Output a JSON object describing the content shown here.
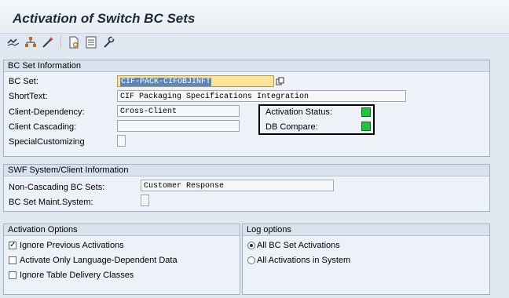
{
  "window": {
    "title": "Activation of Switch BC Sets"
  },
  "toolbar": {
    "icons": [
      "execute-icon",
      "hierarchy-icon",
      "magic-wand-icon",
      "document-icon",
      "details-icon",
      "wrench-icon"
    ]
  },
  "bc_set_info": {
    "header": "BC Set Information",
    "bc_set_label": "BC Set:",
    "bc_set_value": "CIF-PACK-CIFOBJINFT",
    "shorttext_label": "ShortText:",
    "shorttext_value": "CIF Packaging Specifications Integration",
    "client_dependency_label": "Client-Dependency:",
    "client_dependency_value": "Cross-Client",
    "client_cascading_label": "Client Cascading:",
    "client_cascading_value": "",
    "special_customizing_label": "SpecialCustomizing",
    "activation_status_label": "Activation Status:",
    "db_compare_label": "DB Compare:",
    "status_color": "#22c33a"
  },
  "swf_info": {
    "header": "SWF System/Client Information",
    "noncascading_label": "Non-Cascading BC Sets:",
    "noncascading_value": "Customer Response",
    "maint_system_label": "BC Set Maint.System:"
  },
  "activation_options": {
    "header": "Activation Options",
    "options": [
      {
        "label": "Ignore Previous Activations",
        "checked": true
      },
      {
        "label": "Activate Only Language-Dependent Data",
        "checked": false
      },
      {
        "label": "Ignore Table Delivery Classes",
        "checked": false
      }
    ]
  },
  "log_options": {
    "header": "Log options",
    "options": [
      {
        "label": "All BC Set Activations",
        "selected": true
      },
      {
        "label": "All Activations in System",
        "selected": false
      }
    ]
  }
}
